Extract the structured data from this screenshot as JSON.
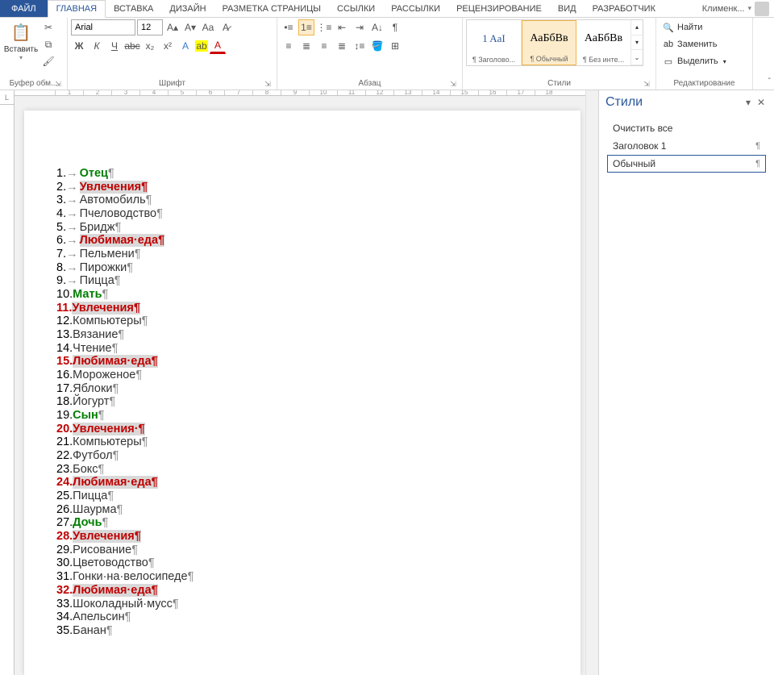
{
  "tabs": {
    "file": "ФАЙЛ",
    "list": [
      "ГЛАВНАЯ",
      "ВСТАВКА",
      "ДИЗАЙН",
      "РАЗМЕТКА СТРАНИЦЫ",
      "ССЫЛКИ",
      "РАССЫЛКИ",
      "РЕЦЕНЗИРОВАНИЕ",
      "ВИД",
      "РАЗРАБОТЧИК"
    ],
    "user": "Клименк..."
  },
  "ribbon": {
    "clipboard": {
      "paste": "Вставить",
      "label": "Буфер обм..."
    },
    "font": {
      "name": "Arial",
      "size": "12",
      "label": "Шрифт"
    },
    "paragraph": {
      "label": "Абзац"
    },
    "styles": {
      "label": "Стили",
      "items": [
        {
          "preview": "1   AaI",
          "label": "¶ Заголово..."
        },
        {
          "preview": "АаБбВв",
          "label": "¶ Обычный"
        },
        {
          "preview": "АаБбВв",
          "label": "¶ Без инте..."
        }
      ]
    },
    "editing": {
      "find": "Найти",
      "replace": "Заменить",
      "select": "Выделить",
      "label": "Редактирование"
    }
  },
  "document": {
    "lines": [
      {
        "n": "1.",
        "arrow": true,
        "text": "Отец",
        "cls": "green",
        "pil": "¶"
      },
      {
        "n": "2.",
        "arrow": true,
        "text": "Увлечения",
        "cls": "red-hl",
        "pil": "¶"
      },
      {
        "n": "3.",
        "arrow": true,
        "text": "Автомобиль",
        "cls": "",
        "pil": "¶"
      },
      {
        "n": "4.",
        "arrow": true,
        "text": "Пчеловодство",
        "cls": "",
        "pil": "¶"
      },
      {
        "n": "5.",
        "arrow": true,
        "text": "Бридж",
        "cls": "",
        "pil": "¶"
      },
      {
        "n": "6.",
        "arrow": true,
        "text": "Любимая·еда",
        "cls": "red-hl",
        "pil": "¶"
      },
      {
        "n": "7.",
        "arrow": true,
        "text": "Пельмени",
        "cls": "",
        "pil": "¶"
      },
      {
        "n": "8.",
        "arrow": true,
        "text": "Пирожки",
        "cls": "",
        "pil": "¶"
      },
      {
        "n": "9.",
        "arrow": true,
        "text": "Пицца",
        "cls": "",
        "pil": "¶"
      },
      {
        "n": "10.",
        "arrow": false,
        "text": "Мать",
        "cls": "green",
        "pil": "¶"
      },
      {
        "n": "11.",
        "arrow": false,
        "ncls": "rednum",
        "text": "Увлечения",
        "cls": "red-hl",
        "pil": "¶"
      },
      {
        "n": "12.",
        "arrow": false,
        "text": "Компьютеры",
        "cls": "",
        "pil": "¶"
      },
      {
        "n": "13.",
        "arrow": false,
        "text": "Вязание",
        "cls": "",
        "pil": "¶"
      },
      {
        "n": "14.",
        "arrow": false,
        "text": "Чтение",
        "cls": "",
        "pil": "¶"
      },
      {
        "n": "15.",
        "arrow": false,
        "ncls": "rednum",
        "text": "Любимая·еда",
        "cls": "red-hl",
        "pil": "¶"
      },
      {
        "n": "16.",
        "arrow": false,
        "text": "Мороженое",
        "cls": "",
        "pil": "¶"
      },
      {
        "n": "17.",
        "arrow": false,
        "text": "Яблоки",
        "cls": "",
        "pil": "¶"
      },
      {
        "n": "18.",
        "arrow": false,
        "text": "Йогурт",
        "cls": "",
        "pil": "¶"
      },
      {
        "n": "19.",
        "arrow": false,
        "text": "Сын",
        "cls": "green",
        "pil": "¶"
      },
      {
        "n": "20.",
        "arrow": false,
        "ncls": "rednum",
        "text": "Увлечения·",
        "cls": "red-hl",
        "pil": "¶"
      },
      {
        "n": "21.",
        "arrow": false,
        "text": "Компьютеры",
        "cls": "",
        "pil": "¶"
      },
      {
        "n": "22.",
        "arrow": false,
        "text": "Футбол",
        "cls": "",
        "pil": "¶"
      },
      {
        "n": "23.",
        "arrow": false,
        "text": "Бокс",
        "cls": "",
        "pil": "¶"
      },
      {
        "n": "24.",
        "arrow": false,
        "ncls": "rednum",
        "text": "Любимая·еда",
        "cls": "red-hl",
        "pil": "¶"
      },
      {
        "n": "25.",
        "arrow": false,
        "text": "Пицца",
        "cls": "",
        "pil": "¶"
      },
      {
        "n": "26.",
        "arrow": false,
        "text": "Шаурма",
        "cls": "",
        "pil": "¶"
      },
      {
        "n": "27.",
        "arrow": false,
        "text": "Дочь",
        "cls": "green",
        "pil": "¶"
      },
      {
        "n": "28.",
        "arrow": false,
        "ncls": "rednum",
        "text": "Увлечения",
        "cls": "red-hl",
        "pil": "¶"
      },
      {
        "n": "29.",
        "arrow": false,
        "text": "Рисование",
        "cls": "",
        "pil": "¶"
      },
      {
        "n": "30.",
        "arrow": false,
        "text": "Цветоводство",
        "cls": "",
        "pil": "¶"
      },
      {
        "n": "31.",
        "arrow": false,
        "text": "Гонки·на·велосипеде",
        "cls": "",
        "pil": "¶"
      },
      {
        "n": "32.",
        "arrow": false,
        "ncls": "rednum",
        "text": "Любимая·еда",
        "cls": "red-hl",
        "pil": "¶"
      },
      {
        "n": "33.",
        "arrow": false,
        "text": "Шоколадный·мусс",
        "cls": "",
        "pil": "¶"
      },
      {
        "n": "34.",
        "arrow": false,
        "text": "Апельсин",
        "cls": "",
        "pil": "¶"
      },
      {
        "n": "35.",
        "arrow": false,
        "text": "Банан",
        "cls": "",
        "pil": "¶"
      }
    ]
  },
  "stylesPane": {
    "title": "Стили",
    "clear": "Очистить все",
    "items": [
      {
        "name": "Заголовок 1",
        "mark": "¶"
      },
      {
        "name": "Обычный",
        "mark": "¶",
        "sel": true
      }
    ]
  },
  "ruler": {
    "marks": [
      "1",
      "2",
      "3",
      "4",
      "5",
      "6",
      "7",
      "8",
      "9",
      "10",
      "11",
      "12",
      "13",
      "14",
      "15",
      "16",
      "17",
      "18"
    ]
  }
}
